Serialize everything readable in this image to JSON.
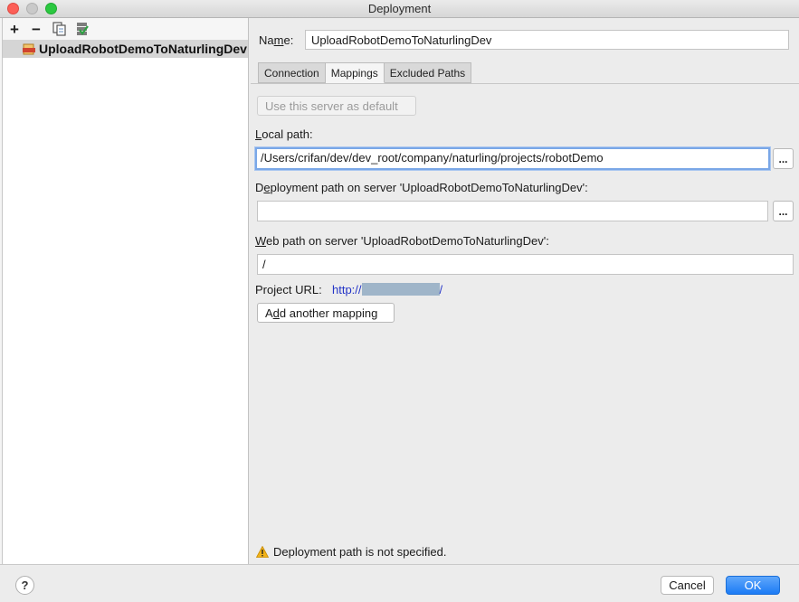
{
  "window": {
    "title": "Deployment"
  },
  "toolbar": {
    "add_glyph": "+",
    "remove_glyph": "−"
  },
  "servers": {
    "items": [
      {
        "label": "UploadRobotDemoToNaturlingDev",
        "type": "sftp"
      }
    ]
  },
  "form": {
    "name_label_prefix": "Na",
    "name_label_mnemonic": "m",
    "name_label_suffix": "e:",
    "name_value": "UploadRobotDemoToNaturlingDev"
  },
  "tabs": [
    {
      "label": "Connection",
      "active": false
    },
    {
      "label": "Mappings",
      "active": true
    },
    {
      "label": "Excluded Paths",
      "active": false
    }
  ],
  "mappings": {
    "use_default_label": "Use this server as default",
    "local_path_mnemonic": "L",
    "local_path_rest": "ocal path:",
    "local_path_value": "/Users/crifan/dev/dev_root/company/naturling/projects/robotDemo",
    "deployment_path_prefix": "D",
    "deployment_path_mnemonic": "e",
    "deployment_path_rest": "ployment path on server 'UploadRobotDemoToNaturlingDev':",
    "deployment_path_value": "",
    "web_path_mnemonic": "W",
    "web_path_rest": "eb path on server 'UploadRobotDemoToNaturlingDev':",
    "web_path_value": "/",
    "project_url_label": "Project URL:",
    "project_url_prefix": "http://",
    "project_url_suffix": "/",
    "add_mapping_prefix": "A",
    "add_mapping_mnemonic": "d",
    "add_mapping_rest": "d another mapping",
    "browse_label": "..."
  },
  "status": {
    "warning_text": "Deployment path is not specified."
  },
  "footer": {
    "help_label": "?",
    "cancel_label": "Cancel",
    "ok_label": "OK"
  },
  "colors": {
    "accent": "#1c7bf5",
    "link": "#2334c7",
    "selection": "#d5d5d5",
    "warning": "#f2b31a"
  }
}
